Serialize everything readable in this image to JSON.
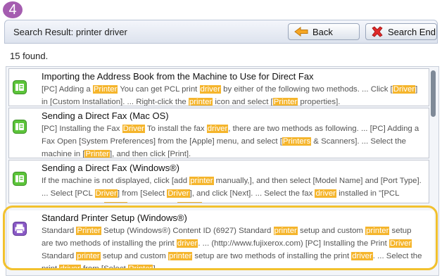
{
  "step": "4",
  "header": {
    "title": "Search Result: printer driver",
    "back_label": "Back",
    "end_label": "Search End"
  },
  "results_count": "15 found.",
  "colors": {
    "highlight": "#f5b52c",
    "selection": "#f2c12e",
    "fax_icon": "#5cc43a",
    "printer_icon": "#8a5ac6"
  },
  "results": [
    {
      "icon": "fax-icon",
      "title": "Importing the Address Book from the Machine to Use for Direct Fax",
      "segments": [
        {
          "t": "[PC] Adding a "
        },
        {
          "t": "Printer",
          "h": true
        },
        {
          "t": " You can get PCL print "
        },
        {
          "t": "driver",
          "h": true
        },
        {
          "t": " by either of the following two methods. ... Click ["
        },
        {
          "t": "Driver",
          "h": true
        },
        {
          "t": "] in [Custom Installation]. ... Right-click the "
        },
        {
          "t": "printer",
          "h": true
        },
        {
          "t": " icon and select ["
        },
        {
          "t": "Printer",
          "h": true
        },
        {
          "t": " properties]."
        }
      ]
    },
    {
      "icon": "fax-icon",
      "title": "Sending a Direct Fax (Mac OS)",
      "segments": [
        {
          "t": "[PC] Installing the Fax "
        },
        {
          "t": "Driver",
          "h": true
        },
        {
          "t": " To install the fax "
        },
        {
          "t": "driver",
          "h": true
        },
        {
          "t": ", there are two methods as following. ... [PC] Adding a Fax Open [System Preferences] from the [Apple] menu, and select ["
        },
        {
          "t": "Printers",
          "h": true
        },
        {
          "t": " & Scanners]. ... Select the machine in ["
        },
        {
          "t": "Printer",
          "h": true
        },
        {
          "t": "], and then click [Print]."
        }
      ]
    },
    {
      "icon": "fax-icon",
      "title": "Sending a Direct Fax (Windows®)",
      "segments": [
        {
          "t": "If the machine is not displayed, click [add "
        },
        {
          "t": "printer",
          "h": true
        },
        {
          "t": " manually,], and then select [Model Name] and [Port Type]. ... Select [PCL "
        },
        {
          "t": "Driver",
          "h": true
        },
        {
          "t": "] from [Select "
        },
        {
          "t": "Driver",
          "h": true
        },
        {
          "t": "], and click [Next]. ... Select the fax "
        },
        {
          "t": "driver",
          "h": true
        },
        {
          "t": " installed in \"[PCL Installing the Fax "
        },
        {
          "t": "Driver",
          "h": true
        },
        {
          "t": "\" from [Select "
        },
        {
          "t": "Printer",
          "h": true
        },
        {
          "t": "], and click [Preferences]."
        }
      ]
    },
    {
      "icon": "printer-icon",
      "title": "Standard Printer Setup (Windows®)",
      "segments": [
        {
          "t": "Standard "
        },
        {
          "t": "Printer",
          "h": true
        },
        {
          "t": " Setup (Windows®) Content ID (6927) Standard "
        },
        {
          "t": "printer",
          "h": true
        },
        {
          "t": " setup and custom "
        },
        {
          "t": "printer",
          "h": true
        },
        {
          "t": " setup are two methods of installing the print "
        },
        {
          "t": "driver",
          "h": true
        },
        {
          "t": ". ... (http://www.fujixerox.com) [PC] Installing the Print "
        },
        {
          "t": "Driver",
          "h": true
        },
        {
          "t": " Standard "
        },
        {
          "t": "printer",
          "h": true
        },
        {
          "t": " setup and custom "
        },
        {
          "t": "printer",
          "h": true
        },
        {
          "t": " setup are two methods of installing the print "
        },
        {
          "t": "driver",
          "h": true
        },
        {
          "t": ". ... Select the print "
        },
        {
          "t": "driver",
          "h": true
        },
        {
          "t": " from [Select "
        },
        {
          "t": "Printer",
          "h": true
        },
        {
          "t": "]."
        }
      ]
    }
  ]
}
